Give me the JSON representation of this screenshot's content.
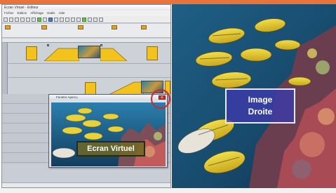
{
  "editor": {
    "title": "Ecran Virtuel - Editeur",
    "menu": [
      "Fichier",
      "Edition",
      "Affichage",
      "Outils",
      "Aide"
    ],
    "statusbar": ""
  },
  "preview": {
    "title": "Fenetre Apercu",
    "close_label": "x",
    "overlay_label": "Ecran Virtuel"
  },
  "right_image": {
    "label_line1": "Image",
    "label_line2": "Droite"
  },
  "colors": {
    "clip": "#f4c21c",
    "highlight_circle": "#d1262a",
    "accent_strip": "#e8743b",
    "image_label_bg": "#3c3aaa",
    "virtual_label_bg": "#6e6923"
  },
  "icons": [
    "file-icon",
    "save-icon",
    "cut-icon",
    "copy-icon",
    "paste-icon",
    "undo-icon",
    "play-icon",
    "stop-icon",
    "zoom-icon"
  ]
}
